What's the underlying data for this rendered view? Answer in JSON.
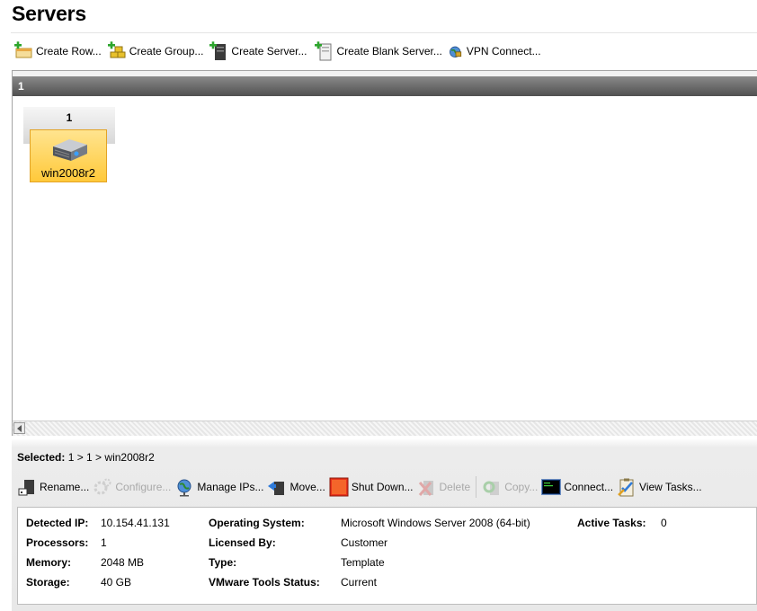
{
  "page": {
    "title": "Servers"
  },
  "top_toolbar": [
    {
      "id": "create-row",
      "label": "Create Row...",
      "icon": "create-row-icon"
    },
    {
      "id": "create-group",
      "label": "Create Group...",
      "icon": "create-group-icon"
    },
    {
      "id": "create-server",
      "label": "Create Server...",
      "icon": "create-server-icon"
    },
    {
      "id": "create-blank-server",
      "label": "Create Blank Server...",
      "icon": "create-blank-server-icon"
    },
    {
      "id": "vpn-connect",
      "label": "VPN Connect...",
      "icon": "vpn-globe-icon"
    }
  ],
  "row": {
    "label": "1"
  },
  "group": {
    "label": "1"
  },
  "server": {
    "name": "win2008r2",
    "icon": "server-icon"
  },
  "selection": {
    "label": "Selected:",
    "path": "1 > 1 > win2008r2"
  },
  "bottom_toolbar": [
    {
      "id": "rename",
      "label": "Rename...",
      "icon": "rename-icon",
      "enabled": true
    },
    {
      "id": "configure",
      "label": "Configure...",
      "icon": "configure-gear-icon",
      "enabled": false
    },
    {
      "id": "manage-ips",
      "label": "Manage IPs...",
      "icon": "manage-ips-globe-icon",
      "enabled": true
    },
    {
      "id": "move",
      "label": "Move...",
      "icon": "move-icon",
      "enabled": true
    },
    {
      "id": "shut-down",
      "label": "Shut Down...",
      "icon": "shut-down-icon",
      "enabled": true
    },
    {
      "id": "delete",
      "label": "Delete",
      "icon": "delete-icon",
      "enabled": false
    },
    {
      "id": "copy",
      "label": "Copy...",
      "icon": "copy-icon",
      "enabled": false
    },
    {
      "id": "connect",
      "label": "Connect...",
      "icon": "console-icon",
      "enabled": true
    },
    {
      "id": "view-tasks",
      "label": "View Tasks...",
      "icon": "view-tasks-icon",
      "enabled": true
    }
  ],
  "details": {
    "detected_ip": {
      "label": "Detected IP:",
      "value": "10.154.41.131"
    },
    "processors": {
      "label": "Processors:",
      "value": "1"
    },
    "memory": {
      "label": "Memory:",
      "value": "2048 MB"
    },
    "storage": {
      "label": "Storage:",
      "value": "40 GB"
    },
    "operating_system": {
      "label": "Operating System:",
      "value": "Microsoft Windows Server 2008 (64-bit)"
    },
    "licensed_by": {
      "label": "Licensed By:",
      "value": "Customer"
    },
    "type": {
      "label": "Type:",
      "value": "Template"
    },
    "vmware_tools_status": {
      "label": "VMware Tools Status:",
      "value": "Current"
    },
    "active_tasks": {
      "label": "Active Tasks:",
      "value": "0"
    }
  },
  "colors": {
    "selected_tile": "#ffc93a",
    "row_header": "#5c5c5c",
    "shutdown_red": "#e8321c"
  }
}
